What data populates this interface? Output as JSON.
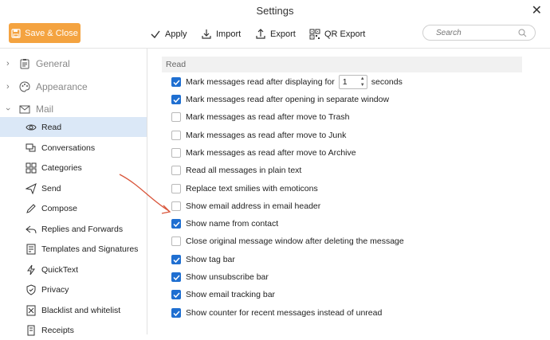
{
  "window": {
    "title": "Settings"
  },
  "toolbar": {
    "save_label": "Save & Close",
    "apply_label": "Apply",
    "import_label": "Import",
    "export_label": "Export",
    "qr_export_label": "QR Export",
    "search_placeholder": "Search"
  },
  "sidebar": {
    "groups": [
      {
        "label": "General",
        "icon": "clipboard-icon"
      },
      {
        "label": "Appearance",
        "icon": "palette-icon"
      },
      {
        "label": "Mail",
        "icon": "mail-icon"
      }
    ],
    "items": [
      {
        "label": "Read",
        "icon": "eye-icon"
      },
      {
        "label": "Conversations",
        "icon": "chat-icon"
      },
      {
        "label": "Categories",
        "icon": "grid-icon"
      },
      {
        "label": "Send",
        "icon": "send-icon"
      },
      {
        "label": "Compose",
        "icon": "pencil-icon"
      },
      {
        "label": "Replies and Forwards",
        "icon": "reply-icon"
      },
      {
        "label": "Templates and Signatures",
        "icon": "template-icon"
      },
      {
        "label": "QuickText",
        "icon": "lightning-icon"
      },
      {
        "label": "Privacy",
        "icon": "shield-icon"
      },
      {
        "label": "Blacklist and whitelist",
        "icon": "blacklist-icon"
      },
      {
        "label": "Receipts",
        "icon": "receipt-icon"
      }
    ]
  },
  "main": {
    "section_title": "Read",
    "options": [
      {
        "label": "Mark messages read after displaying for",
        "checked": true,
        "spinner_value": "1",
        "suffix": "seconds"
      },
      {
        "label": "Mark messages read after opening in separate window",
        "checked": true
      },
      {
        "label": "Mark messages as read after move to Trash",
        "checked": false
      },
      {
        "label": "Mark messages as read after move to Junk",
        "checked": false
      },
      {
        "label": "Mark messages as read after move to Archive",
        "checked": false
      },
      {
        "label": "Read all messages in plain text",
        "checked": false
      },
      {
        "label": "Replace text smilies with emoticons",
        "checked": false
      },
      {
        "label": "Show email address in email header",
        "checked": false
      },
      {
        "label": "Show name from contact",
        "checked": true
      },
      {
        "label": "Close original message window after deleting the message",
        "checked": false
      },
      {
        "label": "Show tag bar",
        "checked": true
      },
      {
        "label": "Show unsubscribe bar",
        "checked": true
      },
      {
        "label": "Show email tracking bar",
        "checked": true
      },
      {
        "label": "Show counter for recent messages instead of unread",
        "checked": true
      }
    ]
  },
  "colors": {
    "accent": "#f4a340",
    "checkbox": "#1f6fd1",
    "selection": "#dbe8f7",
    "annotation_arrow": "#d9553a"
  }
}
